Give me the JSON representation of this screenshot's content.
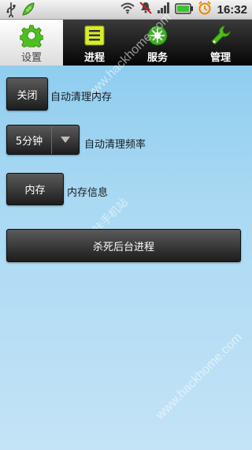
{
  "status_bar": {
    "time": "16:32",
    "icons": [
      "usb-icon",
      "pea-icon",
      "wifi-icon",
      "mute-icon",
      "signal-icon",
      "battery-icon",
      "alarm-icon"
    ],
    "battery_color": "#39c335"
  },
  "tabs": [
    {
      "label": "设置",
      "icon": "gear-icon",
      "active": true
    },
    {
      "label": "进程",
      "icon": "process-list-icon",
      "active": false
    },
    {
      "label": "服务",
      "icon": "service-icon",
      "active": false
    },
    {
      "label": "管理",
      "icon": "wrench-icon",
      "active": false
    }
  ],
  "settings": {
    "auto_clean": {
      "button": "关闭",
      "label": "自动清理内存"
    },
    "frequency": {
      "value": "5分钟",
      "label": "自动清理频率"
    },
    "memory": {
      "button": "内存",
      "label": "内存信息"
    },
    "kill_button": "杀死后台进程"
  },
  "watermarks": [
    "www.hackhome.com",
    "好咔手机站",
    "www.hackhome.com"
  ],
  "colors": {
    "accent_green": "#4fbf1f",
    "panel_blue": "#a9d9f3"
  }
}
